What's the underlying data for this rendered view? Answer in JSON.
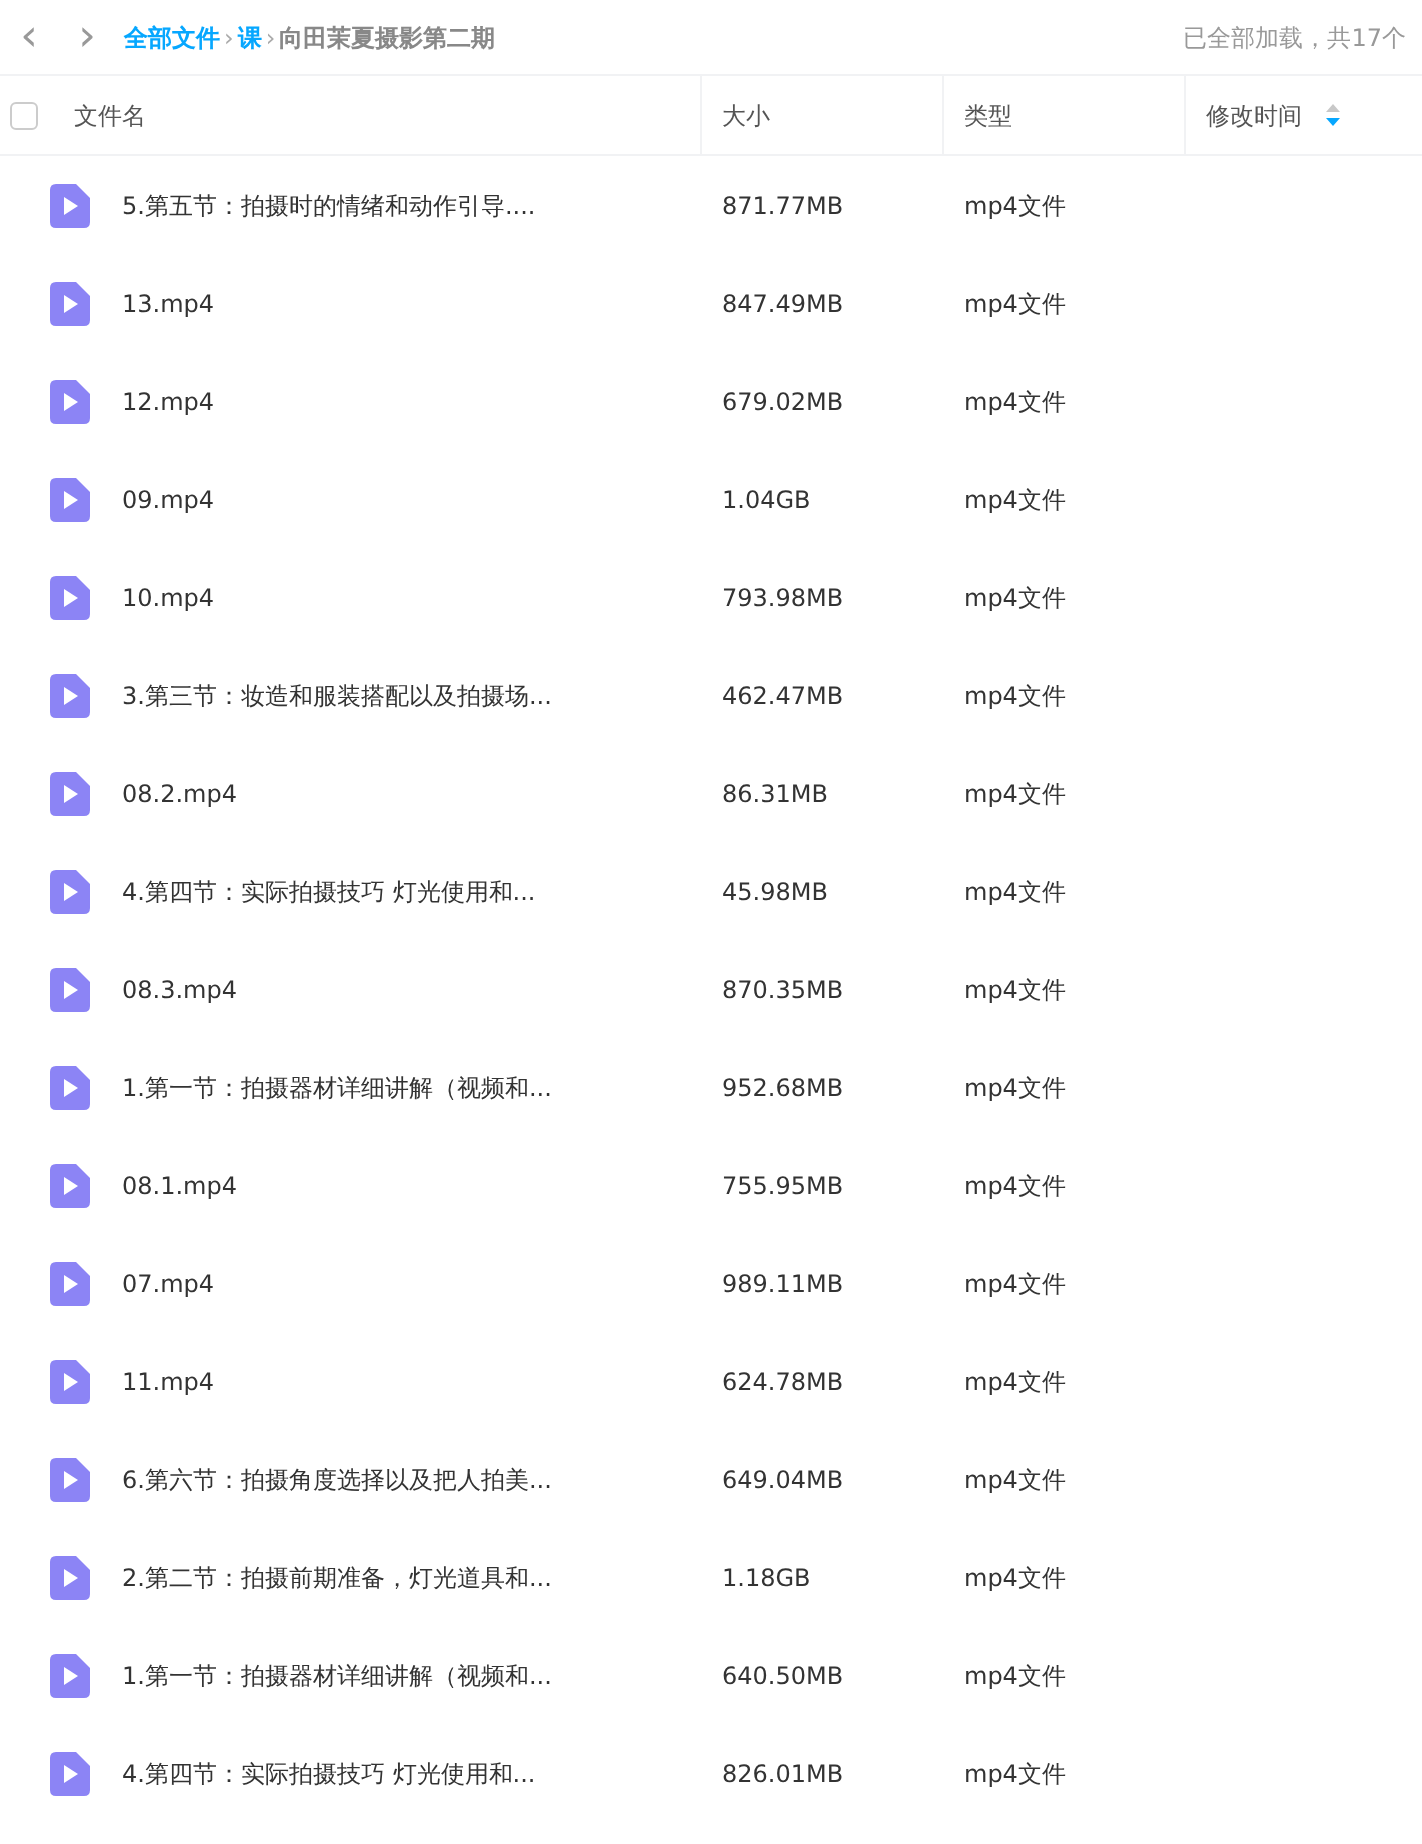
{
  "breadcrumb": {
    "back": "‹",
    "forward": "›",
    "items": [
      {
        "label": "全部文件",
        "current": false
      },
      {
        "label": "课",
        "current": false
      },
      {
        "label": "向田茉夏摄影第二期",
        "current": true
      }
    ],
    "separator": "›",
    "status": "已全部加载，共17个"
  },
  "table": {
    "select_all": {
      "checked": false
    },
    "columns": [
      {
        "label": "文件名",
        "sorted": false
      },
      {
        "label": "大小",
        "sorted": false
      },
      {
        "label": "类型",
        "sorted": false
      },
      {
        "label": "修改时间",
        "sorted": true
      }
    ],
    "rows": [
      {
        "name": "5.第五节：拍摄时的情绪和动作引导....",
        "size": "871.77MB",
        "type": "mp4文件"
      },
      {
        "name": "13.mp4",
        "size": "847.49MB",
        "type": "mp4文件"
      },
      {
        "name": "12.mp4",
        "size": "679.02MB",
        "type": "mp4文件"
      },
      {
        "name": "09.mp4",
        "size": "1.04GB",
        "type": "mp4文件"
      },
      {
        "name": "10.mp4",
        "size": "793.98MB",
        "type": "mp4文件"
      },
      {
        "name": "3.第三节：妆造和服装搭配以及拍摄场...",
        "size": "462.47MB",
        "type": "mp4文件"
      },
      {
        "name": "08.2.mp4",
        "size": "86.31MB",
        "type": "mp4文件"
      },
      {
        "name": "4.第四节：实际拍摄技巧 灯光使用和...",
        "size": "45.98MB",
        "type": "mp4文件"
      },
      {
        "name": "08.3.mp4",
        "size": "870.35MB",
        "type": "mp4文件"
      },
      {
        "name": "1.第一节：拍摄器材详细讲解（视频和...",
        "size": "952.68MB",
        "type": "mp4文件"
      },
      {
        "name": "08.1.mp4",
        "size": "755.95MB",
        "type": "mp4文件"
      },
      {
        "name": "07.mp4",
        "size": "989.11MB",
        "type": "mp4文件"
      },
      {
        "name": "11.mp4",
        "size": "624.78MB",
        "type": "mp4文件"
      },
      {
        "name": "6.第六节：拍摄角度选择以及把人拍美...",
        "size": "649.04MB",
        "type": "mp4文件"
      },
      {
        "name": "2.第二节：拍摄前期准备，灯光道具和...",
        "size": "1.18GB",
        "type": "mp4文件"
      },
      {
        "name": "1.第一节：拍摄器材详细讲解（视频和...",
        "size": "640.50MB",
        "type": "mp4文件"
      },
      {
        "name": "4.第四节：实际拍摄技巧 灯光使用和...",
        "size": "826.01MB",
        "type": "mp4文件"
      }
    ]
  }
}
